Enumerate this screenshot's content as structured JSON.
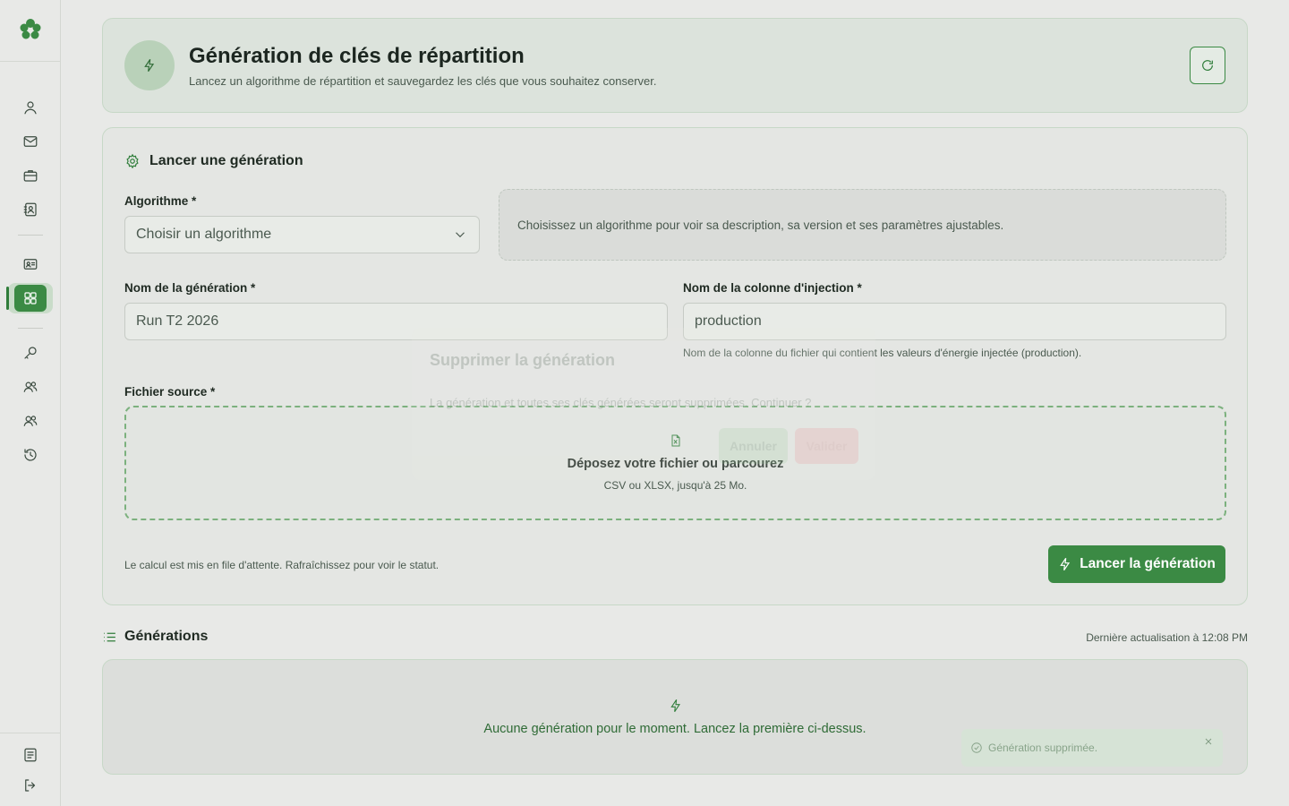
{
  "header": {
    "title": "Génération de clés de répartition",
    "subtitle": "Lancez un algorithme de répartition et sauvegardez les clés que vous souhaitez conserver."
  },
  "form": {
    "section_title": "Lancer une génération",
    "algorithm_label": "Algorithme *",
    "algorithm_placeholder": "Choisir un algorithme",
    "algorithm_hint": "Choisissez un algorithme pour voir sa description, sa version et ses paramètres ajustables.",
    "name_label": "Nom de la génération *",
    "name_value": "Run T2 2026",
    "column_label": "Nom de la colonne d'injection *",
    "column_value": "production",
    "column_help": "Nom de la colonne du fichier qui contient les valeurs d'énergie injectée (production).",
    "file_label": "Fichier source *",
    "dropzone_title": "Déposez votre fichier ou parcourez",
    "dropzone_sub": "CSV ou XLSX, jusqu'à 25 Mo.",
    "queue_note": "Le calcul est mis en file d'attente. Rafraîchissez pour voir le statut.",
    "launch_label": "Lancer la génération"
  },
  "generations": {
    "title": "Générations",
    "last_update": "Dernière actualisation à 12:08 PM",
    "empty_text": "Aucune génération pour le moment. Lancez la première ci-dessus."
  },
  "modal": {
    "title": "Supprimer la génération",
    "text": "La génération et toutes ses clés générées seront supprimées. Continuer ?",
    "cancel_label": "Annuler",
    "confirm_label": "Valider"
  },
  "toast": {
    "text": "Génération supprimée."
  },
  "colors": {
    "accent": "#3b8a44",
    "background": "#e8e9e7",
    "danger": "#e9b4b4"
  }
}
